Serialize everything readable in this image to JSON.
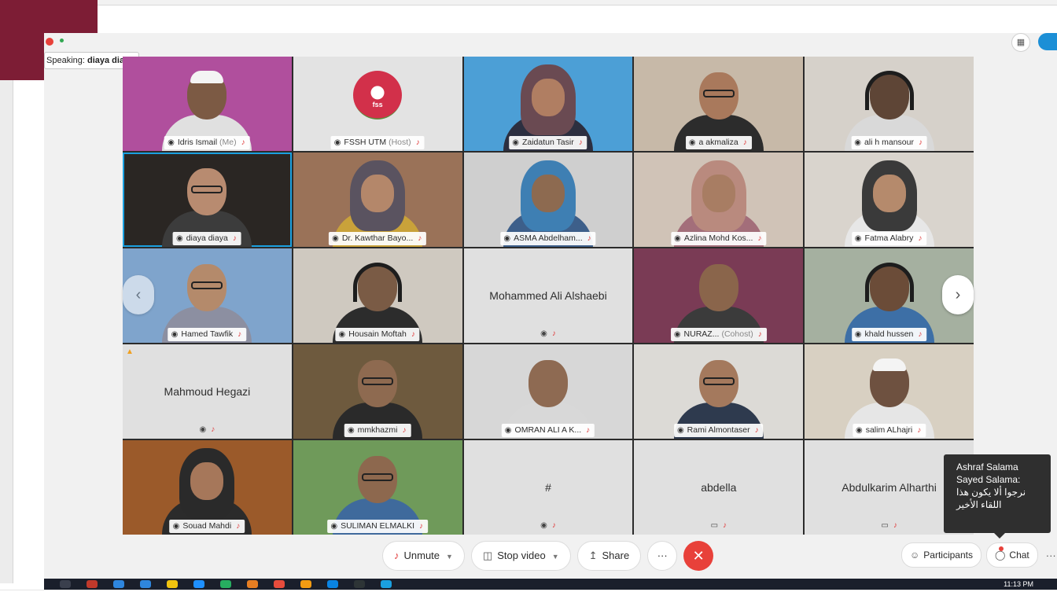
{
  "speaking": {
    "label": "Speaking:",
    "name": "diaya diaya"
  },
  "header": {
    "grid_icon": "grid-icon"
  },
  "colors": {
    "accent": "#1aa0e0",
    "end_call": "#e8413a",
    "muted_mic": "#e03a3a",
    "frame": "#7d1d35"
  },
  "tiles": [
    {
      "name": "Idris Ismail",
      "role": "(Me)",
      "bg": "#b04f9d",
      "skin": "#7c5a44",
      "shirt": "#e0e0e0",
      "style": "cap"
    },
    {
      "name": "FSSH UTM",
      "role": "(Host)",
      "bg": "#e3e3e3",
      "logo_text": "fss"
    },
    {
      "name": "Zaidatun Tasir",
      "role": "",
      "bg": "#4c9fd6",
      "skin": "#b07e62",
      "shirt": "#2c2f40",
      "style": "hijab",
      "hijab": "#6a4a52"
    },
    {
      "name": "a akmaliza",
      "role": "",
      "bg": "#c7b9a8",
      "skin": "#a9795c",
      "shirt": "#2c2c2c",
      "style": "glasses"
    },
    {
      "name": "ali h mansour",
      "role": "",
      "bg": "#d6d1ca",
      "skin": "#5e4536",
      "shirt": "#d9d9d9",
      "style": "headset"
    },
    {
      "name": "diaya diaya",
      "role": "",
      "bg": "#2a2623",
      "skin": "#b88b70",
      "shirt": "#3c3c3c",
      "style": "glasses"
    },
    {
      "name": "Dr. Kawthar Bayo...",
      "role": "",
      "bg": "#9a7258",
      "skin": "#b4876a",
      "shirt": "#c9a23a",
      "style": "hijab",
      "hijab": "#5a5360"
    },
    {
      "name": "ASMA Abdelham...",
      "role": "",
      "bg": "#cfcfcf",
      "skin": "#8d6a50",
      "shirt": "#3d5f8a",
      "style": "hijab",
      "hijab": "#3e7fb3"
    },
    {
      "name": "Azlina Mohd Kos...",
      "role": "",
      "bg": "#d0c3b7",
      "skin": "#a87d63",
      "shirt": "#a36e7a",
      "style": "hijab",
      "hijab": "#b98a7e"
    },
    {
      "name": "Fatma Alabry",
      "role": "",
      "bg": "#d9d4cd",
      "skin": "#b58a6c",
      "shirt": "#e7e7e7",
      "style": "hijab",
      "hijab": "#3a3a3a"
    },
    {
      "name": "Hamed Tawfik",
      "role": "",
      "bg": "#7fa4cc",
      "skin": "#b48a6b",
      "shirt": "#8c8fa1",
      "style": "glasses"
    },
    {
      "name": "Housain Moftah",
      "role": "",
      "bg": "#cfc9c0",
      "skin": "#7a5b45",
      "shirt": "#2c2c2c",
      "style": "headset"
    },
    {
      "name": "Mohammed Ali Alshaebi",
      "role": "",
      "placeholder": true
    },
    {
      "name": "NURAZ...",
      "role": "(Cohost)",
      "bg": "#7a3b55",
      "skin": "#8a654b",
      "shirt": "#3b3b3b",
      "style": "plain"
    },
    {
      "name": "khald hussen",
      "role": "",
      "bg": "#a5b0a0",
      "skin": "#6b4c38",
      "shirt": "#3d6fa6",
      "style": "headset"
    },
    {
      "name": "Mahmoud Hegazi",
      "role": "",
      "placeholder": true,
      "warning": true
    },
    {
      "name": "mmkhazmi",
      "role": "",
      "bg": "#6e5a3e",
      "skin": "#8e6a50",
      "shirt": "#2a2a2a",
      "style": "glasses"
    },
    {
      "name": "OMRAN ALI A K...",
      "role": "",
      "bg": "#d7d7d7",
      "skin": "#8e6a52",
      "shirt": "#d8d8d8",
      "style": "plain"
    },
    {
      "name": "Rami Almontaser",
      "role": "",
      "bg": "#dcdad6",
      "skin": "#a4795d",
      "shirt": "#2e3a4e",
      "style": "glasses"
    },
    {
      "name": "salim ALhajri",
      "role": "",
      "bg": "#d8d0c2",
      "skin": "#6e5140",
      "shirt": "#e6e6e6",
      "style": "cap"
    },
    {
      "name": "Souad Mahdi",
      "role": "",
      "bg": "#9b5a2a",
      "skin": "#a6775a",
      "shirt": "#2b2b2b",
      "style": "hijab",
      "hijab": "#2a2a2a"
    },
    {
      "name": "SULIMAN ELMALKI",
      "role": "",
      "bg": "#6f9a5a",
      "skin": "#8d684e",
      "shirt": "#3f6a9c",
      "style": "glasses"
    },
    {
      "name": "#",
      "role": "",
      "placeholder": true
    },
    {
      "name": "abdella",
      "role": "",
      "placeholder": true,
      "status_icon": "screen"
    },
    {
      "name": "Abdulkarim Alharthi",
      "role": "",
      "placeholder": true,
      "status_icon": "screen"
    }
  ],
  "toolbar": {
    "unmute": "Unmute",
    "stop_video": "Stop video",
    "share": "Share",
    "more": "···",
    "end": "✕"
  },
  "right_tools": {
    "participants": "Participants",
    "chat": "Chat",
    "more": "···"
  },
  "chat_popup": {
    "sender_line1": "Ashraf Salama",
    "sender_line2": "Sayed Salama:",
    "message": "نرجوا ألا يكون هذا اللقاء الأخير"
  },
  "taskbar": {
    "clock": "11:13 PM"
  },
  "nav": {
    "prev": "‹",
    "next": "›"
  }
}
